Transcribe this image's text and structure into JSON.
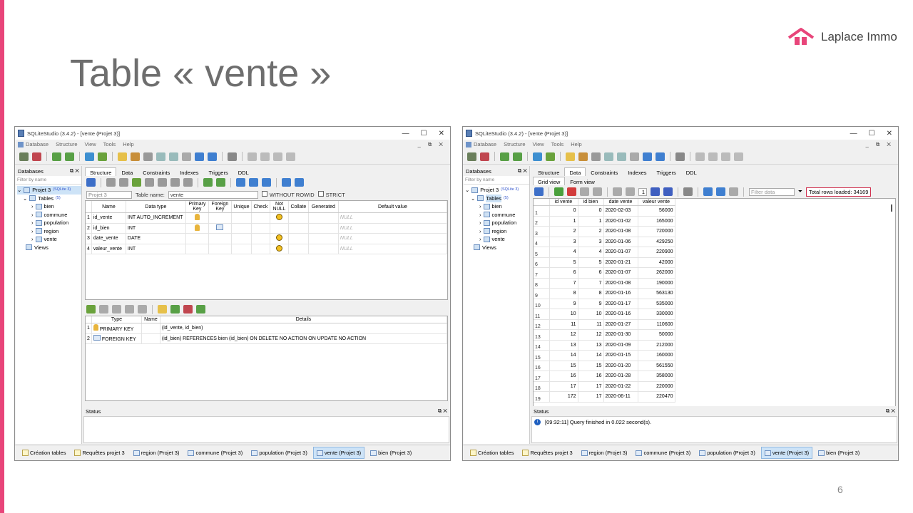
{
  "slide": {
    "title": "Table « vente »",
    "page_number": "6",
    "logo_text": "Laplace Immo",
    "accent_color": "#e8457a"
  },
  "left": {
    "window_title": "SQLiteStudio (3.4.2) - [vente (Projet 3)]",
    "menu": [
      "Database",
      "Structure",
      "View",
      "Tools",
      "Help"
    ],
    "databases_label": "Databases",
    "filter_placeholder": "Filter by name",
    "tree": {
      "project": "Projet 3",
      "project_badge": "(SQLite 3)",
      "tables_label": "Tables",
      "tables_count": "(5)",
      "tables": [
        "bien",
        "commune",
        "population",
        "region",
        "vente"
      ],
      "views_label": "Views"
    },
    "tabs": [
      "Structure",
      "Data",
      "Constraints",
      "Indexes",
      "Triggers",
      "DDL"
    ],
    "db_select": "Projet 3",
    "table_name_label": "Table name:",
    "table_name_value": "vente",
    "without_rowid": "WITHOUT ROWID",
    "strict": "STRICT",
    "columns_headers": [
      "Name",
      "Data type",
      "Primary Key",
      "Foreign Key",
      "Unique",
      "Check",
      "Not NULL",
      "Collate",
      "Generated",
      "Default value"
    ],
    "columns": [
      {
        "n": "1",
        "name": "id_vente",
        "type": "INT AUTO_INCREMENT",
        "pk": true,
        "fk": false,
        "notnull": true,
        "default": "NULL"
      },
      {
        "n": "2",
        "name": "id_bien",
        "type": "INT",
        "pk": true,
        "fk": true,
        "notnull": false,
        "default": "NULL"
      },
      {
        "n": "3",
        "name": "date_vente",
        "type": "DATE",
        "pk": false,
        "fk": false,
        "notnull": true,
        "default": "NULL"
      },
      {
        "n": "4",
        "name": "valeur_vente",
        "type": "INT",
        "pk": false,
        "fk": false,
        "notnull": true,
        "default": "NULL"
      }
    ],
    "constraints_headers": [
      "Type",
      "Name",
      "Details"
    ],
    "constraints": [
      {
        "n": "1",
        "type": "PRIMARY KEY",
        "name": "",
        "details": "(id_vente, id_bien)"
      },
      {
        "n": "2",
        "type": "FOREIGN KEY",
        "name": "",
        "details": "(id_bien) REFERENCES bien (id_bien) ON DELETE NO ACTION ON UPDATE NO ACTION"
      }
    ],
    "status_label": "Status",
    "taskbar": [
      {
        "label": "Création tables",
        "kind": "note",
        "active": false
      },
      {
        "label": "Requêtes projet 3",
        "kind": "note",
        "active": false
      },
      {
        "label": "region (Projet 3)",
        "kind": "table",
        "active": false
      },
      {
        "label": "commune (Projet 3)",
        "kind": "table",
        "active": false
      },
      {
        "label": "population (Projet 3)",
        "kind": "table",
        "active": false
      },
      {
        "label": "vente (Projet 3)",
        "kind": "table",
        "active": true
      },
      {
        "label": "bien (Projet 3)",
        "kind": "table",
        "active": false
      }
    ]
  },
  "right": {
    "window_title": "SQLiteStudio (3.4.2) - [vente (Projet 3)]",
    "menu": [
      "Database",
      "Structure",
      "View",
      "Tools",
      "Help"
    ],
    "databases_label": "Databases",
    "filter_placeholder": "Filter by name",
    "tree": {
      "project": "Projet 3",
      "project_badge": "(SQLite 3)",
      "tables_label": "Tables",
      "tables_count": "(5)",
      "tables": [
        "bien",
        "commune",
        "population",
        "region",
        "vente"
      ],
      "views_label": "Views"
    },
    "tabs": [
      "Structure",
      "Data",
      "Constraints",
      "Indexes",
      "Triggers",
      "DDL"
    ],
    "subtabs": [
      "Grid view",
      "Form view"
    ],
    "page_field": "1",
    "filter_data_placeholder": "Filter data",
    "total_rows": "Total rows loaded: 34169",
    "data_headers": [
      "id vente",
      "id bien",
      "date vente",
      "valeur vente"
    ],
    "rows": [
      [
        "1",
        "0",
        "0",
        "2020-02-03",
        "56000"
      ],
      [
        "2",
        "1",
        "1",
        "2020-01-02",
        "165000"
      ],
      [
        "3",
        "2",
        "2",
        "2020-01-08",
        "720000"
      ],
      [
        "4",
        "3",
        "3",
        "2020-01-06",
        "429250"
      ],
      [
        "5",
        "4",
        "4",
        "2020-01-07",
        "220900"
      ],
      [
        "6",
        "5",
        "5",
        "2020-01-21",
        "42000"
      ],
      [
        "7",
        "6",
        "6",
        "2020-01-07",
        "262000"
      ],
      [
        "8",
        "7",
        "7",
        "2020-01-08",
        "190000"
      ],
      [
        "9",
        "8",
        "8",
        "2020-01-16",
        "563130"
      ],
      [
        "10",
        "9",
        "9",
        "2020-01-17",
        "535000"
      ],
      [
        "11",
        "10",
        "10",
        "2020-01-16",
        "330000"
      ],
      [
        "12",
        "11",
        "11",
        "2020-01-27",
        "110600"
      ],
      [
        "13",
        "12",
        "12",
        "2020-01-30",
        "50000"
      ],
      [
        "14",
        "13",
        "13",
        "2020-01-09",
        "212000"
      ],
      [
        "15",
        "14",
        "14",
        "2020-01-15",
        "160000"
      ],
      [
        "16",
        "15",
        "15",
        "2020-01-20",
        "561550"
      ],
      [
        "17",
        "16",
        "16",
        "2020-01-28",
        "358000"
      ],
      [
        "18",
        "17",
        "17",
        "2020-01-22",
        "220000"
      ],
      [
        "19",
        "172",
        "17",
        "2020-06-11",
        "220470"
      ]
    ],
    "status_label": "Status",
    "status_message": "[09:32:11]  Query finished in 0.022 second(s).",
    "taskbar": [
      {
        "label": "Création tables",
        "kind": "note",
        "active": false
      },
      {
        "label": "Requêtes projet 3",
        "kind": "note",
        "active": false
      },
      {
        "label": "region (Projet 3)",
        "kind": "table",
        "active": false
      },
      {
        "label": "commune (Projet 3)",
        "kind": "table",
        "active": false
      },
      {
        "label": "population (Projet 3)",
        "kind": "table",
        "active": false
      },
      {
        "label": "vente (Projet 3)",
        "kind": "table",
        "active": true
      },
      {
        "label": "bien (Projet 3)",
        "kind": "table",
        "active": false
      }
    ]
  }
}
